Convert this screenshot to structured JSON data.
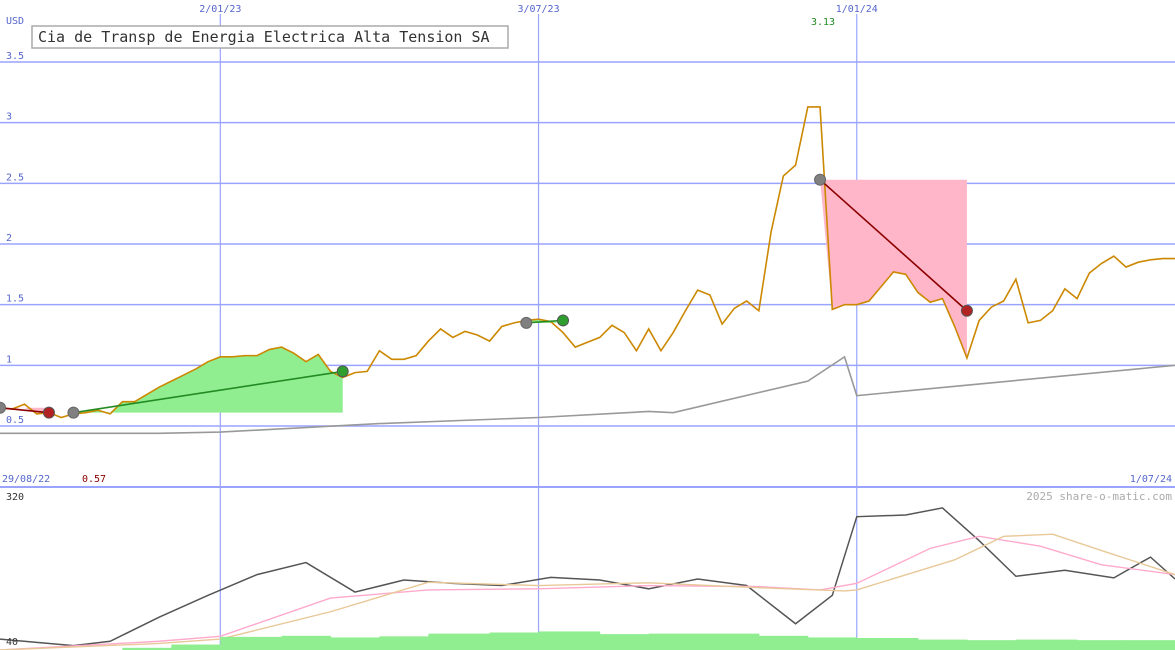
{
  "chart_data": {
    "type": "line",
    "title": "Cia de Transp de Energia Electrica Alta Tension SA",
    "currency": "USD",
    "watermark": "2025 share-o-matic.com",
    "date_range": {
      "start": "29/08/22",
      "end": "1/07/24"
    },
    "x_tick_labels": [
      "2/01/23",
      "3/07/23",
      "1/01/24"
    ],
    "price_axis": {
      "ylim": [
        0.5,
        3.5
      ],
      "ticks": [
        "3.5",
        "3",
        "2.5",
        "2",
        "1.5",
        "1",
        "0.5"
      ]
    },
    "indicator_axis": {
      "ylim": [
        40,
        320
      ],
      "ticks": [
        "320",
        "40"
      ]
    },
    "annotations": {
      "max": {
        "label": "3.13",
        "date": "2024-01-01",
        "value": 3.13
      },
      "min": {
        "label": "0.57",
        "date": "2022-09-26",
        "value": 0.57
      }
    },
    "colors": {
      "price": "#cc8800",
      "ma": "#999999",
      "grid": "#9aa4ff",
      "gain": "#90ee90",
      "loss": "#ffb6c8",
      "gain_line": "#228b22",
      "loss_line": "#8b0000",
      "osc": "#555555",
      "osc_pink": "#ffaacc",
      "osc_tan": "#e8c898",
      "volume": "#90ee90",
      "axis_text": "#5566cc",
      "max_text": "#228b22",
      "min_text": "#8b0000"
    },
    "series": [
      {
        "key": "price",
        "x": [
          "2022-08-29",
          "2022-09-05",
          "2022-09-12",
          "2022-09-19",
          "2022-09-26",
          "2022-10-03",
          "2022-10-10",
          "2022-10-17",
          "2022-10-24",
          "2022-10-31",
          "2022-11-07",
          "2022-11-14",
          "2022-11-21",
          "2022-11-28",
          "2022-12-05",
          "2022-12-12",
          "2022-12-19",
          "2022-12-26",
          "2023-01-02",
          "2023-01-09",
          "2023-01-16",
          "2023-01-23",
          "2023-01-30",
          "2023-02-06",
          "2023-02-13",
          "2023-02-20",
          "2023-02-27",
          "2023-03-06",
          "2023-03-13",
          "2023-03-20",
          "2023-03-27",
          "2023-04-03",
          "2023-04-10",
          "2023-04-17",
          "2023-04-24",
          "2023-05-01",
          "2023-05-08",
          "2023-05-15",
          "2023-05-22",
          "2023-05-29",
          "2023-06-05",
          "2023-06-12",
          "2023-06-19",
          "2023-06-26",
          "2023-07-03",
          "2023-07-10",
          "2023-07-17",
          "2023-07-24",
          "2023-07-31",
          "2023-08-07",
          "2023-08-14",
          "2023-08-21",
          "2023-08-28",
          "2023-09-04",
          "2023-09-11",
          "2023-09-18",
          "2023-09-25",
          "2023-10-02",
          "2023-10-09",
          "2023-10-16",
          "2023-10-23",
          "2023-10-30",
          "2023-11-06",
          "2023-11-13",
          "2023-11-20",
          "2023-11-27",
          "2023-12-04",
          "2023-12-11",
          "2023-12-18",
          "2023-12-25",
          "2024-01-01",
          "2024-01-08",
          "2024-01-15",
          "2024-01-22",
          "2024-01-29",
          "2024-02-05",
          "2024-02-12",
          "2024-02-19",
          "2024-02-26",
          "2024-03-04",
          "2024-03-11",
          "2024-03-18",
          "2024-03-25",
          "2024-04-01",
          "2024-04-08",
          "2024-04-15",
          "2024-04-22",
          "2024-04-29",
          "2024-05-06",
          "2024-05-13",
          "2024-05-20",
          "2024-05-27",
          "2024-06-03",
          "2024-06-10",
          "2024-06-17",
          "2024-06-24",
          "2024-07-01"
        ],
        "values": [
          0.65,
          0.64,
          0.68,
          0.6,
          0.61,
          0.57,
          0.6,
          0.61,
          0.63,
          0.6,
          0.7,
          0.7,
          0.76,
          0.82,
          0.87,
          0.92,
          0.97,
          1.03,
          1.07,
          1.07,
          1.08,
          1.08,
          1.13,
          1.15,
          1.1,
          1.03,
          1.09,
          0.95,
          0.9,
          0.94,
          0.95,
          1.12,
          1.05,
          1.05,
          1.08,
          1.2,
          1.3,
          1.23,
          1.28,
          1.25,
          1.2,
          1.32,
          1.35,
          1.37,
          1.38,
          1.36,
          1.27,
          1.15,
          1.19,
          1.23,
          1.33,
          1.27,
          1.12,
          1.3,
          1.12,
          1.27,
          1.45,
          1.62,
          1.58,
          1.34,
          1.47,
          1.53,
          1.45,
          2.1,
          2.56,
          2.65,
          3.13,
          3.13,
          1.46,
          1.5,
          1.5,
          1.53,
          1.65,
          1.77,
          1.75,
          1.6,
          1.52,
          1.55,
          1.32,
          1.06,
          1.37,
          1.48,
          1.53,
          1.71,
          1.35,
          1.37,
          1.45,
          1.63,
          1.55,
          1.76,
          1.84,
          1.9,
          1.81,
          1.85,
          1.87,
          1.88,
          1.88
        ]
      },
      {
        "key": "ma",
        "x": [
          "2022-08-29",
          "2022-11-28",
          "2023-01-02",
          "2023-04-03",
          "2023-07-03",
          "2023-09-04",
          "2023-09-18",
          "2023-12-04",
          "2023-12-25",
          "2024-01-01",
          "2024-07-01"
        ],
        "values": [
          0.44,
          0.44,
          0.45,
          0.52,
          0.57,
          0.62,
          0.61,
          0.87,
          1.07,
          0.75,
          1.0
        ]
      }
    ],
    "trades": [
      {
        "type": "loss",
        "entry": {
          "date": "2022-08-29",
          "value": 0.65
        },
        "exit": {
          "date": "2022-09-26",
          "value": 0.61
        }
      },
      {
        "type": "gain",
        "entry": {
          "date": "2022-10-10",
          "value": 0.61
        },
        "exit": {
          "date": "2023-03-13",
          "value": 0.95
        }
      },
      {
        "type": "gain",
        "entry": {
          "date": "2023-06-26",
          "value": 1.35
        },
        "exit": {
          "date": "2023-07-17",
          "value": 1.37
        }
      },
      {
        "type": "loss",
        "entry": {
          "date": "2023-12-11",
          "value": 2.53
        },
        "exit": {
          "date": "2024-03-04",
          "value": 1.45
        }
      }
    ],
    "indicator_series": [
      {
        "key": "osc",
        "x": [
          "2022-08-29",
          "2022-09-19",
          "2022-10-10",
          "2022-10-31",
          "2022-11-28",
          "2022-12-26",
          "2023-01-23",
          "2023-02-20",
          "2023-03-20",
          "2023-04-17",
          "2023-05-15",
          "2023-06-12",
          "2023-07-10",
          "2023-08-07",
          "2023-09-04",
          "2023-10-02",
          "2023-10-30",
          "2023-11-27",
          "2023-12-18",
          "2024-01-01",
          "2024-01-29",
          "2024-02-19",
          "2024-03-11",
          "2024-04-01",
          "2024-04-29",
          "2024-05-27",
          "2024-06-17",
          "2024-07-01"
        ],
        "values": [
          60,
          54,
          48,
          56,
          100,
          140,
          178,
          200,
          146,
          168,
          162,
          158,
          173,
          168,
          152,
          170,
          158,
          88,
          140,
          284,
          287,
          300,
          240,
          175,
          186,
          172,
          210,
          170
        ]
      },
      {
        "key": "osc_pink",
        "x": [
          "2022-08-29",
          "2022-11-28",
          "2023-01-02",
          "2023-03-06",
          "2023-05-01",
          "2023-07-03",
          "2023-09-04",
          "2023-11-06",
          "2023-12-11",
          "2024-01-01",
          "2024-02-12",
          "2024-03-11",
          "2024-04-15",
          "2024-05-20",
          "2024-07-01"
        ],
        "values": [
          40,
          56,
          65,
          135,
          150,
          152,
          158,
          156,
          150,
          162,
          226,
          248,
          230,
          196,
          178
        ]
      },
      {
        "key": "osc_tan",
        "x": [
          "2022-08-29",
          "2022-11-28",
          "2023-01-02",
          "2023-03-06",
          "2023-05-01",
          "2023-07-03",
          "2023-09-04",
          "2023-11-06",
          "2023-12-25",
          "2024-01-01",
          "2024-02-26",
          "2024-03-25",
          "2024-04-22",
          "2024-05-20",
          "2024-07-01"
        ],
        "values": [
          40,
          52,
          60,
          110,
          164,
          158,
          163,
          154,
          148,
          150,
          205,
          248,
          252,
          222,
          178
        ]
      }
    ],
    "volume": {
      "x": [
        "2022-08-29",
        "2022-10-03",
        "2022-11-07",
        "2022-12-05",
        "2023-01-02",
        "2023-02-06",
        "2023-03-06",
        "2023-04-03",
        "2023-05-01",
        "2023-06-05",
        "2023-07-03",
        "2023-08-07",
        "2023-09-04",
        "2023-10-02",
        "2023-11-06",
        "2023-12-04",
        "2024-01-01",
        "2024-02-05",
        "2024-03-04",
        "2024-04-01",
        "2024-05-06",
        "2024-06-03",
        "2024-07-01"
      ],
      "values": [
        36,
        40,
        44,
        50,
        64,
        66,
        63,
        65,
        70,
        72,
        74,
        69,
        70,
        70,
        66,
        63,
        62,
        59,
        58,
        59,
        58,
        58,
        60
      ]
    }
  }
}
